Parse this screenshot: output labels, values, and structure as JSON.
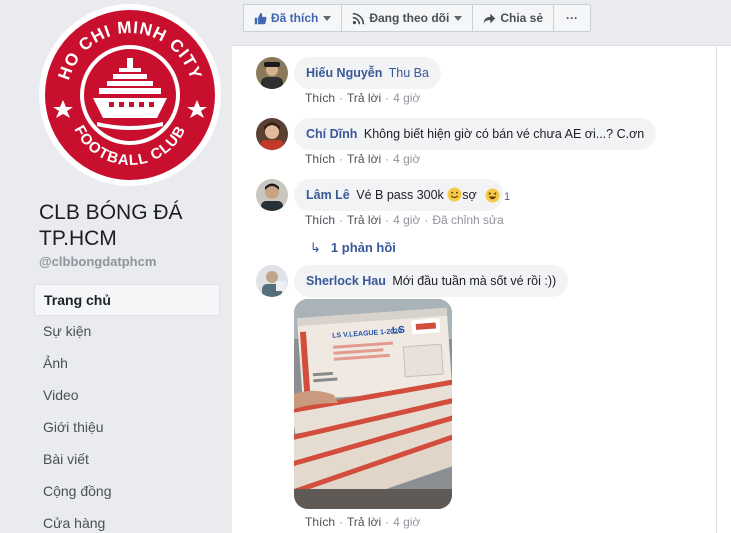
{
  "page": {
    "name": "CLB BÓNG ĐÁ TP.HCM",
    "handle": "@clbbongdatphcm",
    "logo": {
      "top_text": "HO CHI MINH CITY",
      "bottom_text": "FOOTBALL CLUB",
      "color": "#c8102e"
    }
  },
  "nav": [
    {
      "label": "Trang chủ",
      "active": true
    },
    {
      "label": "Sự kiện"
    },
    {
      "label": "Ảnh"
    },
    {
      "label": "Video"
    },
    {
      "label": "Giới thiệu"
    },
    {
      "label": "Bài viết"
    },
    {
      "label": "Cộng đồng"
    },
    {
      "label": "Cửa hàng"
    }
  ],
  "toolbar": {
    "like_label": "Đã thích",
    "follow_label": "Đang theo dõi",
    "share_label": "Chia sẻ",
    "more_label": "···"
  },
  "comments": [
    {
      "author": "Hiếu Nguyễn",
      "mention": "Thu Ba",
      "text": "",
      "actions": {
        "like": "Thích",
        "reply": "Trả lời",
        "time": "4 giờ"
      }
    },
    {
      "author": "Chí Dĩnh",
      "text": "Không biết hiện giờ có bán vé chưa AE ơi...? C.ơn",
      "actions": {
        "like": "Thích",
        "reply": "Trả lời",
        "time": "4 giờ"
      }
    },
    {
      "author": "Lâm Lê",
      "text": "Vé B pass 300k",
      "text_after": "sợ",
      "reaction_count": "1",
      "actions": {
        "like": "Thích",
        "reply": "Trả lời",
        "time": "4 giờ",
        "edited": "Đã chỉnh sửa"
      },
      "replies_label": "1 phản hồi"
    },
    {
      "author": "Sherlock Hau",
      "text": "Mới đầu tuần mà sốt vé rồi :))",
      "actions": {
        "like": "Thích",
        "reply": "Trả lời",
        "time": "4 giờ"
      },
      "photo": {
        "ticket_title": "LS V.LEAGUE 1-2020"
      }
    }
  ]
}
